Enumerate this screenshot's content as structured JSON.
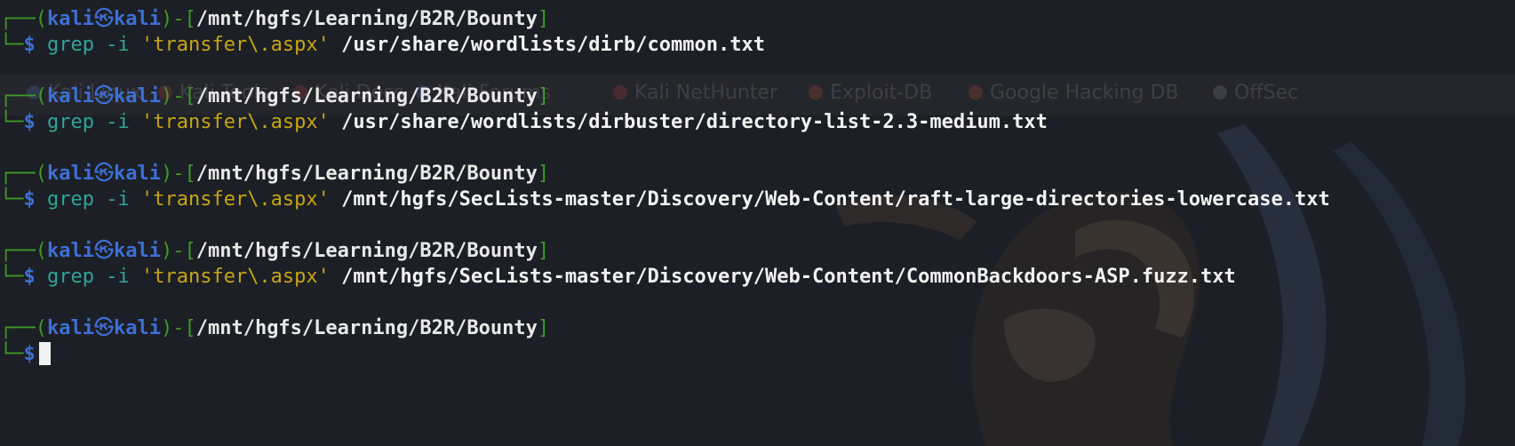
{
  "prompt": {
    "box_open": "┌──(",
    "user": "kali",
    "skull": "㉿",
    "host": "kali",
    "sep": ")-[",
    "cwd": "/mnt/hgfs/Learning/B2R/Bounty",
    "close": "]",
    "box_bottom": "└─",
    "dollar": "$"
  },
  "history": [
    {
      "cmd": "grep",
      "flag": "-i",
      "pattern": "'transfer\\.aspx'",
      "file": "/usr/share/wordlists/dirb/common.txt"
    },
    {
      "cmd": "grep",
      "flag": "-i",
      "pattern": "'transfer\\.aspx'",
      "file": "/usr/share/wordlists/dirbuster/directory-list-2.3-medium.txt"
    },
    {
      "cmd": "grep",
      "flag": "-i",
      "pattern": "'transfer\\.aspx'",
      "file": "/mnt/hgfs/SecLists-master/Discovery/Web-Content/raft-large-directories-lowercase.txt"
    },
    {
      "cmd": "grep",
      "flag": "-i",
      "pattern": "'transfer\\.aspx'",
      "file": "/mnt/hgfs/SecLists-master/Discovery/Web-Content/CommonBackdoors-ASP.fuzz.txt"
    }
  ],
  "background_bookmarks": [
    {
      "label": "Kali Linux",
      "color": "#4a6fb5"
    },
    {
      "label": "Kali Tools",
      "color": "#b53a3a"
    },
    {
      "label": "Kali Docs",
      "color": "#b53a3a"
    },
    {
      "label": "Kali Forums",
      "color": "#4a6fb5"
    },
    {
      "label": "Kali NetHunter",
      "color": "#b53a3a"
    },
    {
      "label": "Exploit-DB",
      "color": "#b5542a"
    },
    {
      "label": "Google Hacking DB",
      "color": "#b5542a"
    },
    {
      "label": "OffSec",
      "color": "#888888"
    }
  ],
  "colors": {
    "frame": "#3f9b28",
    "user": "#3d6fd6",
    "command": "#2ea59a",
    "string": "#c7a514",
    "argument": "#f2f2f2",
    "background": "#1c1f25"
  }
}
